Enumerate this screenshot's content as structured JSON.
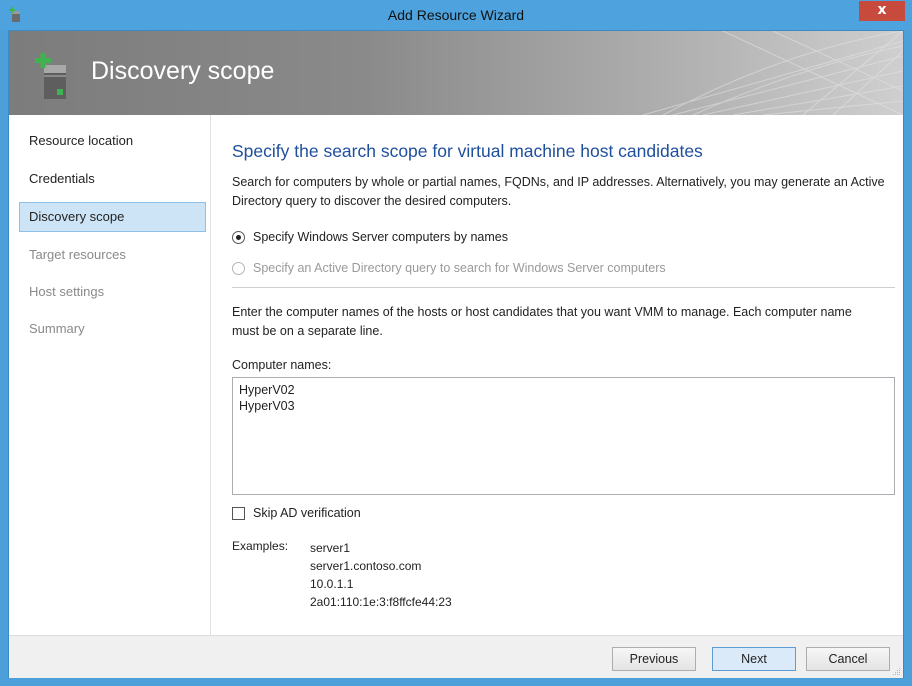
{
  "window": {
    "title": "Add Resource Wizard",
    "close_glyph": "x",
    "icon": "add-host-icon"
  },
  "banner": {
    "title": "Discovery scope",
    "icon": "add-host-icon"
  },
  "nav": {
    "items": [
      {
        "label": "Resource location",
        "state": "normal"
      },
      {
        "label": "Credentials",
        "state": "normal"
      },
      {
        "label": "Discovery scope",
        "state": "active"
      },
      {
        "label": "Target resources",
        "state": "disabled"
      },
      {
        "label": "Host settings",
        "state": "disabled"
      },
      {
        "label": "Summary",
        "state": "disabled"
      }
    ]
  },
  "main": {
    "heading": "Specify the search scope for virtual machine host candidates",
    "description": "Search for computers by whole or partial names, FQDNs, and IP addresses. Alternatively, you may generate an Active Directory query to discover the desired computers.",
    "radio_options": [
      {
        "label": "Specify Windows Server computers by names",
        "checked": true,
        "enabled": true
      },
      {
        "label": "Specify an Active Directory query to search for Windows Server computers",
        "checked": false,
        "enabled": false
      }
    ],
    "instructions": "Enter the computer names of the hosts or host candidates that you want VMM to manage. Each computer name must be on a separate line.",
    "computer_names_label": "Computer names:",
    "computer_names": [
      "HyperV02",
      "HyperV03"
    ],
    "skip_ad_label": "Skip AD verification",
    "skip_ad_checked": false,
    "examples_label": "Examples:",
    "examples": [
      "server1",
      "server1.contoso.com",
      "10.0.1.1",
      "2a01:110:1e:3:f8ffcfe44:23"
    ]
  },
  "footer": {
    "previous_label": "Previous",
    "next_label": "Next",
    "cancel_label": "Cancel"
  },
  "colors": {
    "titlebar": "#4ea3df",
    "close_button": "#c74a3d",
    "heading": "#1e4f9c",
    "nav_active": "#cde4f6"
  }
}
